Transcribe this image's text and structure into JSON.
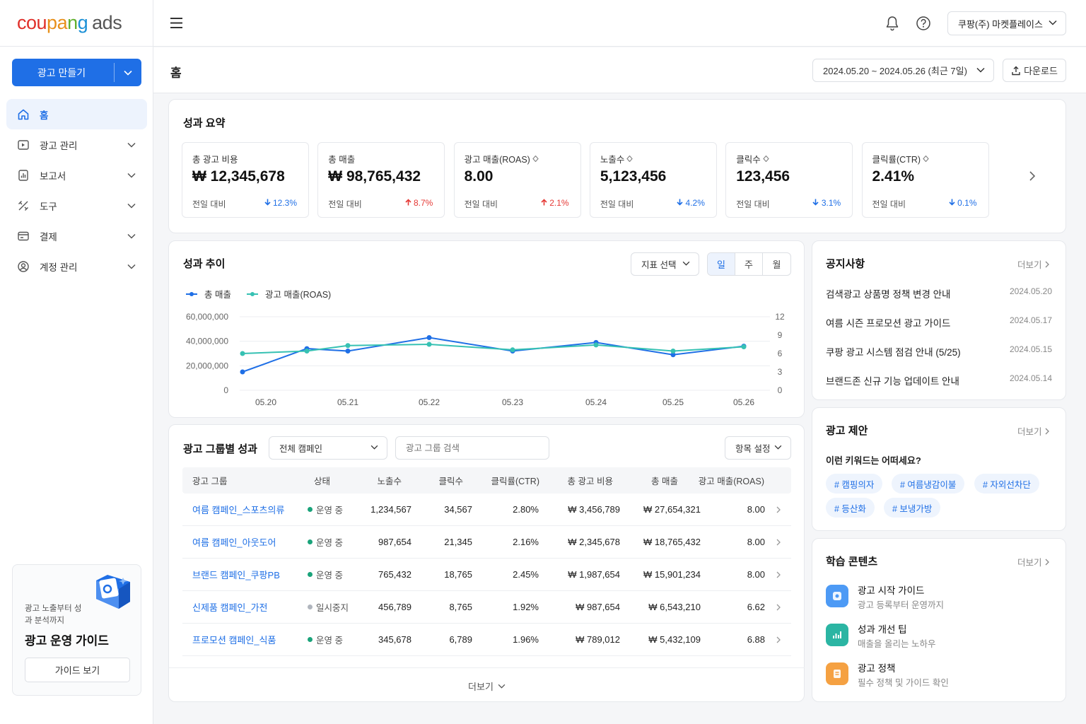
{
  "brand": {
    "logo_parts": [
      "cou",
      "pa",
      "n",
      "g"
    ],
    "logo_suffix": "ads",
    "accent": "#1f6fe6"
  },
  "sidebar": {
    "create_button": "광고 만들기",
    "items": [
      {
        "label": "홈",
        "icon": "home-icon",
        "active": true
      },
      {
        "label": "광고 관리",
        "icon": "ad-icon"
      },
      {
        "label": "보고서",
        "icon": "report-icon"
      },
      {
        "label": "도구",
        "icon": "tools-icon"
      },
      {
        "label": "결제",
        "icon": "payment-icon"
      },
      {
        "label": "계정 관리",
        "icon": "account-icon"
      }
    ],
    "guide": {
      "subtitle": "광고 노출부터 성과 분석까지",
      "title": "광고 운영 가이드",
      "button": "가이드 보기"
    }
  },
  "topbar": {
    "account": "쿠팡(주) 마켓플레이스"
  },
  "page": {
    "title": "홈",
    "date_range": "2024.05.20 ~ 2024.05.26 (최근 7일)",
    "download": "다운로드"
  },
  "summary": {
    "title": "성과 요약",
    "kpis": [
      {
        "label": "총 광고 비용",
        "value": "₩ 12,345,678",
        "compare": "전일 대비",
        "change": "12.3%",
        "dir": "down"
      },
      {
        "label": "총 매출",
        "value": "₩ 98,765,432",
        "compare": "전일 대비",
        "change": "8.7%",
        "dir": "up"
      },
      {
        "label": "광고 매출(ROAS)",
        "value": "8.00",
        "compare": "전일 대비",
        "change": "2.1%",
        "dir": "up"
      },
      {
        "label": "노출수",
        "value": "5,123,456",
        "compare": "전일 대비",
        "change": "4.2%",
        "dir": "down"
      },
      {
        "label": "클릭수",
        "value": "123,456",
        "compare": "전일 대비",
        "change": "3.1%",
        "dir": "down"
      },
      {
        "label": "클릭률(CTR)",
        "value": "2.41%",
        "compare": "전일 대비",
        "change": "0.1%",
        "dir": "down"
      }
    ]
  },
  "trend": {
    "title": "성과 추이",
    "metric_select": "지표 선택",
    "periods": [
      "일",
      "주",
      "월"
    ],
    "active_period": "일"
  },
  "chart_data": {
    "type": "line",
    "x": [
      "05.20",
      "05.21",
      "05.22",
      "05.23",
      "05.24",
      "05.25",
      "05.26"
    ],
    "series": [
      {
        "name": "총 매출",
        "axis": "left",
        "color": "#1f6fe6",
        "values": [
          15000000,
          34000000,
          32000000,
          43000000,
          32000000,
          39000000,
          29000000,
          36000000
        ]
      },
      {
        "name": "광고 매출(ROAS)",
        "axis": "right",
        "color": "#36c1b3",
        "values": [
          6.0,
          6.4,
          7.3,
          7.5,
          6.6,
          7.4,
          6.4,
          7.1
        ]
      }
    ],
    "y_left": {
      "ticks": [
        "0",
        "20,000,000",
        "40,000,000",
        "60,000,000"
      ],
      "range": [
        0,
        60000000
      ]
    },
    "y_right": {
      "ticks": [
        "0",
        "3",
        "6",
        "9",
        "12"
      ],
      "range": [
        0,
        12
      ]
    },
    "grid": true,
    "legend": "top-left"
  },
  "groups": {
    "title": "광고 그룹별 성과",
    "campaign_filter": "전체 캠페인",
    "search_placeholder": "광고 그룹 검색",
    "settings": "항목 설정",
    "columns": [
      "광고 그룹",
      "상태",
      "노출수",
      "클릭수",
      "클릭률(CTR)",
      "총 광고 비용",
      "총 매출",
      "광고 매출(ROAS)"
    ],
    "rows": [
      {
        "name": "여름 캠페인_스포츠의류",
        "status": "운영 중",
        "active": true,
        "imp": "1,234,567",
        "clk": "34,567",
        "ctr": "2.80%",
        "cost": "₩ 3,456,789",
        "sales": "₩ 27,654,321",
        "roas": "8.00"
      },
      {
        "name": "여름 캠페인_아웃도어",
        "status": "운영 중",
        "active": true,
        "imp": "987,654",
        "clk": "21,345",
        "ctr": "2.16%",
        "cost": "₩ 2,345,678",
        "sales": "₩ 18,765,432",
        "roas": "8.00"
      },
      {
        "name": "브랜드 캠페인_쿠팡PB",
        "status": "운영 중",
        "active": true,
        "imp": "765,432",
        "clk": "18,765",
        "ctr": "2.45%",
        "cost": "₩ 1,987,654",
        "sales": "₩ 15,901,234",
        "roas": "8.00"
      },
      {
        "name": "신제품 캠페인_가전",
        "status": "일시중지",
        "active": false,
        "imp": "456,789",
        "clk": "8,765",
        "ctr": "1.92%",
        "cost": "₩ 987,654",
        "sales": "₩ 6,543,210",
        "roas": "6.62"
      },
      {
        "name": "프로모션 캠페인_식품",
        "status": "운영 중",
        "active": true,
        "imp": "345,678",
        "clk": "6,789",
        "ctr": "1.96%",
        "cost": "₩ 789,012",
        "sales": "₩ 5,432,109",
        "roas": "6.88"
      }
    ],
    "more": "더보기"
  },
  "notices": {
    "title": "공지사항",
    "more": "더보기",
    "items": [
      {
        "title": "검색광고 상품명 정책 변경 안내",
        "date": "2024.05.20"
      },
      {
        "title": "여름 시즌 프로모션 광고 가이드",
        "date": "2024.05.17"
      },
      {
        "title": "쿠팡 광고 시스템 점검 안내 (5/25)",
        "date": "2024.05.15"
      },
      {
        "title": "브랜드존 신규 기능 업데이트 안내",
        "date": "2024.05.14"
      }
    ]
  },
  "suggest": {
    "title": "광고 제안",
    "more": "더보기",
    "question": "이런 키워드는 어떠세요?",
    "tags": [
      "# 캠핑의자",
      "# 여름냉감이불",
      "# 자외선차단",
      "# 등산화",
      "# 보냉가방"
    ]
  },
  "learning": {
    "title": "학습 콘텐츠",
    "more": "더보기",
    "items": [
      {
        "title": "광고 시작 가이드",
        "desc": "광고 등록부터 운영까지",
        "color": "#4d9af5"
      },
      {
        "title": "성과 개선 팁",
        "desc": "매출을 올리는 노하우",
        "color": "#2bb5a3"
      },
      {
        "title": "광고 정책",
        "desc": "필수 정책 및 가이드 확인",
        "color": "#f5a142"
      }
    ]
  }
}
